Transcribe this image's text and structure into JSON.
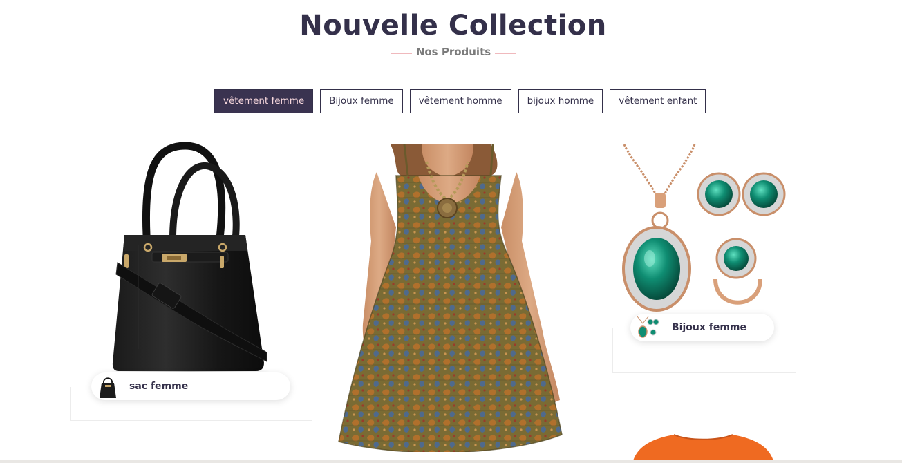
{
  "header": {
    "title": "Nouvelle Collection",
    "subtitle": "Nos Produits"
  },
  "tabs": [
    {
      "label": "vêtement femme",
      "active": true
    },
    {
      "label": "Bijoux femme",
      "active": false
    },
    {
      "label": "vêtement homme",
      "active": false
    },
    {
      "label": "bijoux homme",
      "active": false
    },
    {
      "label": "vêtement enfant",
      "active": false
    }
  ],
  "products": [
    {
      "label": "sac femme",
      "thumb_icon": "handbag-icon"
    },
    {
      "label": "Bijoux femme",
      "thumb_icon": "jewelry-set-icon"
    }
  ],
  "colors": {
    "primary": "#34304a",
    "active_tab_bg": "#3a3350",
    "active_tab_text": "#f6d7dc",
    "accent_line": "#f0b9bd"
  }
}
